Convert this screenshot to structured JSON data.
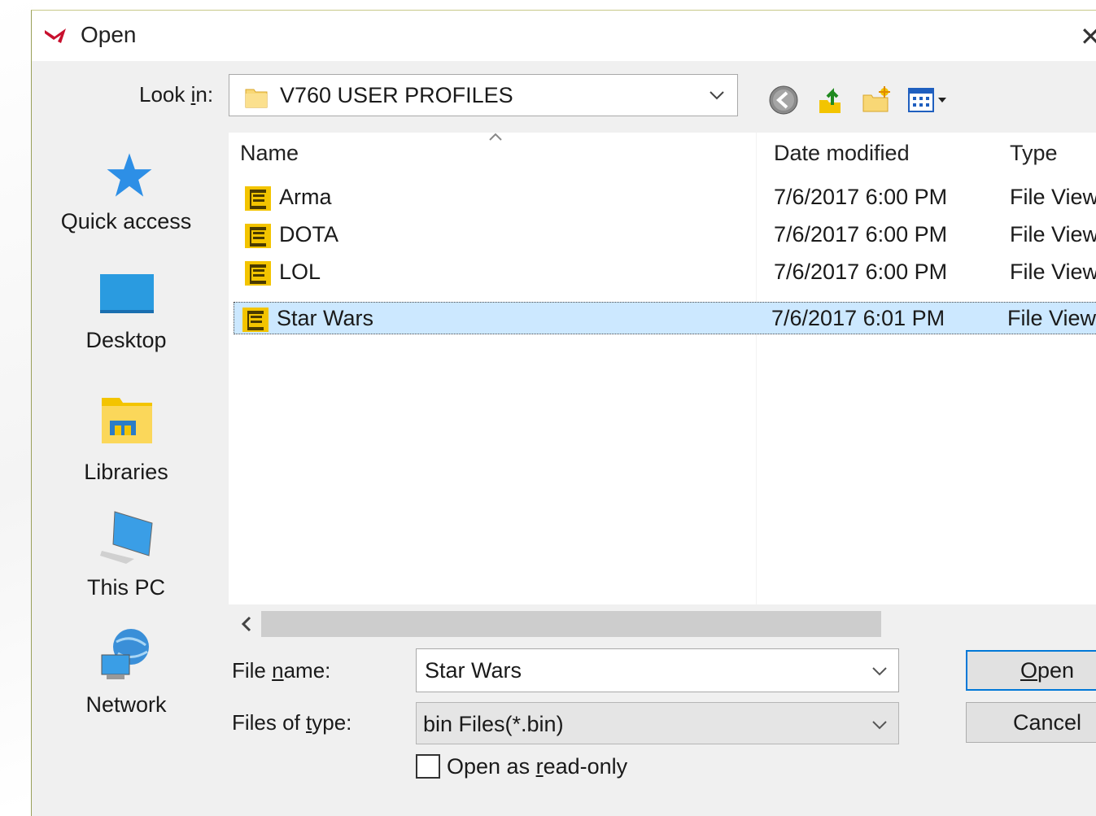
{
  "window": {
    "title": "Open",
    "close_glyph": "✕"
  },
  "look_in": {
    "label_pre": "Look ",
    "label_acc": "i",
    "label_post": "n:",
    "value": "V760 USER PROFILES"
  },
  "toolbar": {
    "icons": [
      "back-icon",
      "up-folder-icon",
      "new-folder-icon",
      "view-menu-icon"
    ]
  },
  "places": [
    {
      "label": "Quick access",
      "icon": "star-icon"
    },
    {
      "label": "Desktop",
      "icon": "desktop-icon"
    },
    {
      "label": "Libraries",
      "icon": "libraries-icon"
    },
    {
      "label": "This PC",
      "icon": "computer-icon"
    },
    {
      "label": "Network",
      "icon": "network-icon"
    }
  ],
  "columns": {
    "name": "Name",
    "date": "Date modified",
    "type": "Type"
  },
  "files": [
    {
      "name": "Arma",
      "date": "7/6/2017 6:00 PM",
      "type": "File View"
    },
    {
      "name": "DOTA",
      "date": "7/6/2017 6:00 PM",
      "type": "File View"
    },
    {
      "name": "LOL",
      "date": "7/6/2017 6:00 PM",
      "type": "File View"
    },
    {
      "name": "Star Wars",
      "date": "7/6/2017 6:01 PM",
      "type": "File View",
      "selected": true
    }
  ],
  "file_name": {
    "label_pre": "File ",
    "label_acc": "n",
    "label_post": "ame:",
    "value": "Star Wars"
  },
  "file_type": {
    "label_pre": "Files of ",
    "label_acc": "t",
    "label_post": "ype:",
    "value": "bin Files(*.bin)"
  },
  "read_only": {
    "label_pre": "Open as ",
    "label_acc": "r",
    "label_post": "ead-only",
    "checked": false
  },
  "buttons": {
    "open_acc": "O",
    "open_post": "pen",
    "cancel": "Cancel"
  },
  "colors": {
    "selection": "#cce8ff",
    "default_button_border": "#0078d7",
    "folder_yellow": "#f3c400"
  }
}
